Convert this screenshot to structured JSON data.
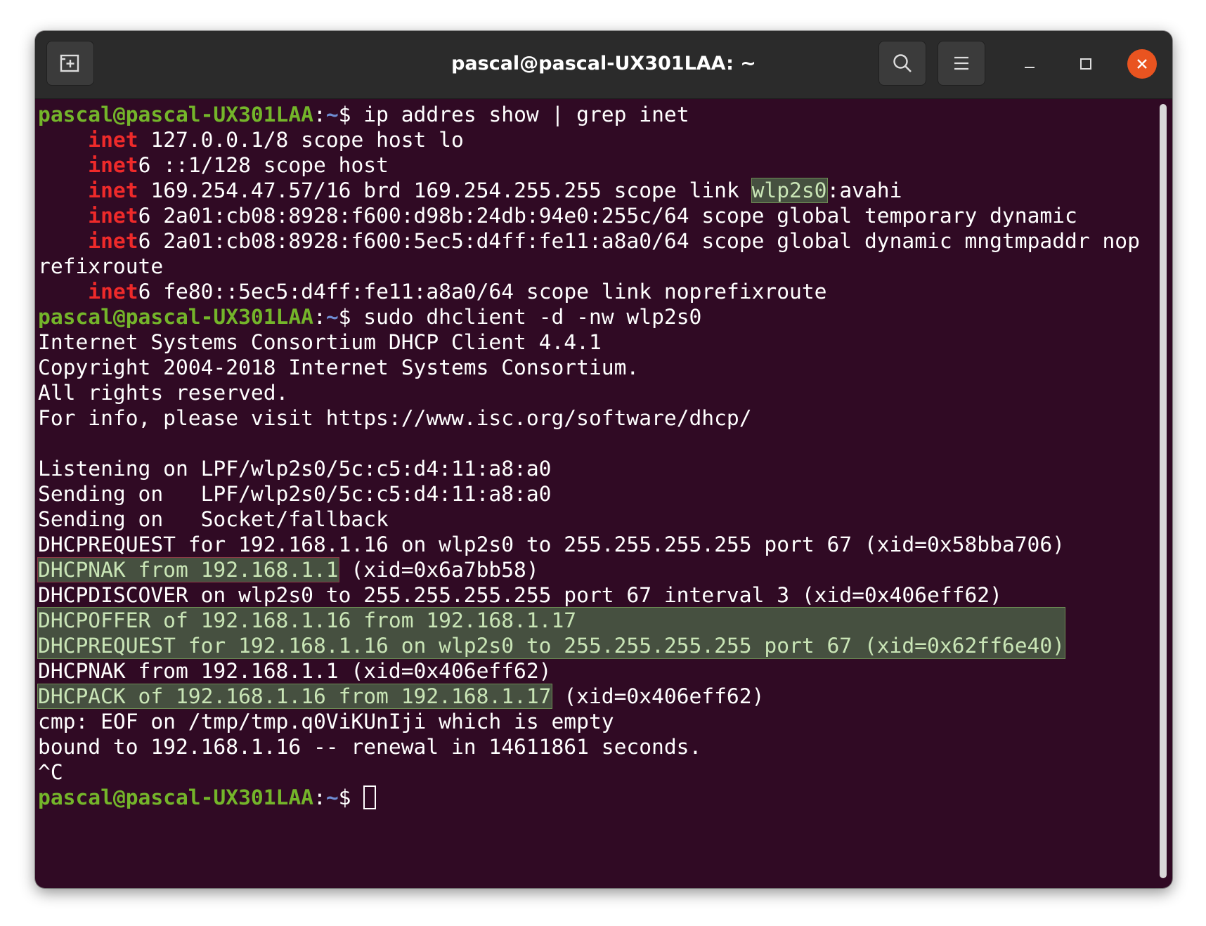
{
  "window": {
    "title": "pascal@pascal-UX301LAA: ~"
  },
  "toolbar": {
    "new_tab_icon": "new-tab-icon",
    "search_icon": "search-icon",
    "menu_icon": "hamburger-menu-icon",
    "minimize_icon": "minimize-icon",
    "maximize_icon": "maximize-icon",
    "close_icon": "close-icon"
  },
  "colors": {
    "terminal_bg": "#300a24",
    "prompt_user": "#74b52a",
    "prompt_path": "#6e8cd2",
    "keyword_red": "#ef2a2a",
    "highlight_bg": "#465040",
    "close_button": "#e95420"
  },
  "terminal": {
    "prompt_user": "pascal@pascal-UX301LAA",
    "prompt_colon": ":",
    "prompt_path": "~",
    "prompt_sign": "$ ",
    "cmd1": "ip addres show | grep inet",
    "l1_kw": "inet",
    "l1_rest": " 127.0.0.1/8 scope host lo",
    "l2_kw": "inet",
    "l2_rest": "6 ::1/128 scope host",
    "l3_kw": "inet",
    "l3_mid": " 169.254.47.57/16 brd 169.254.255.255 scope link ",
    "l3_hl": "wlp2s0",
    "l3_end": ":avahi",
    "l4_kw": "inet",
    "l4_rest": "6 2a01:cb08:8928:f600:d98b:24db:94e0:255c/64 scope global temporary dynamic",
    "l5_kw": "inet",
    "l5_rest": "6 2a01:cb08:8928:f600:5ec5:d4ff:fe11:a8a0/64 scope global dynamic mngtmpaddr nop",
    "l5_wrap": "refixroute",
    "l6_kw": "inet",
    "l6_rest": "6 fe80::5ec5:d4ff:fe11:a8a0/64 scope link noprefixroute",
    "cmd2": "sudo dhclient -d -nw wlp2s0",
    "o1": "Internet Systems Consortium DHCP Client 4.4.1",
    "o2": "Copyright 2004-2018 Internet Systems Consortium.",
    "o3": "All rights reserved.",
    "o4": "For info, please visit https://www.isc.org/software/dhcp/",
    "o5": "Listening on LPF/wlp2s0/5c:c5:d4:11:a8:a0",
    "o6": "Sending on   LPF/wlp2s0/5c:c5:d4:11:a8:a0",
    "o7": "Sending on   Socket/fallback",
    "o8": "DHCPREQUEST for 192.168.1.16 on wlp2s0 to 255.255.255.255 port 67 (xid=0x58bba706)",
    "o9_hl": "DHCPNAK from 192.168.1.1",
    "o9_rest": " (xid=0x6a7bb58)",
    "o10": "DHCPDISCOVER on wlp2s0 to 255.255.255.255 port 67 interval 3 (xid=0x406eff62)",
    "o11": "DHCPOFFER of 192.168.1.16 from 192.168.1.17",
    "o12": "DHCPREQUEST for 192.168.1.16 on wlp2s0 to 255.255.255.255 port 67 (xid=0x62ff6e40)",
    "o13": "DHCPNAK from 192.168.1.1 (xid=0x406eff62)",
    "o14_hl": "DHCPACK of 192.168.1.16 from 192.168.1.17",
    "o14_rest": " (xid=0x406eff62)",
    "o15": "cmp: EOF on /tmp/tmp.q0ViKUnIji which is empty",
    "o16": "bound to 192.168.1.16 -- renewal in 14611861 seconds.",
    "o17": "^C"
  }
}
